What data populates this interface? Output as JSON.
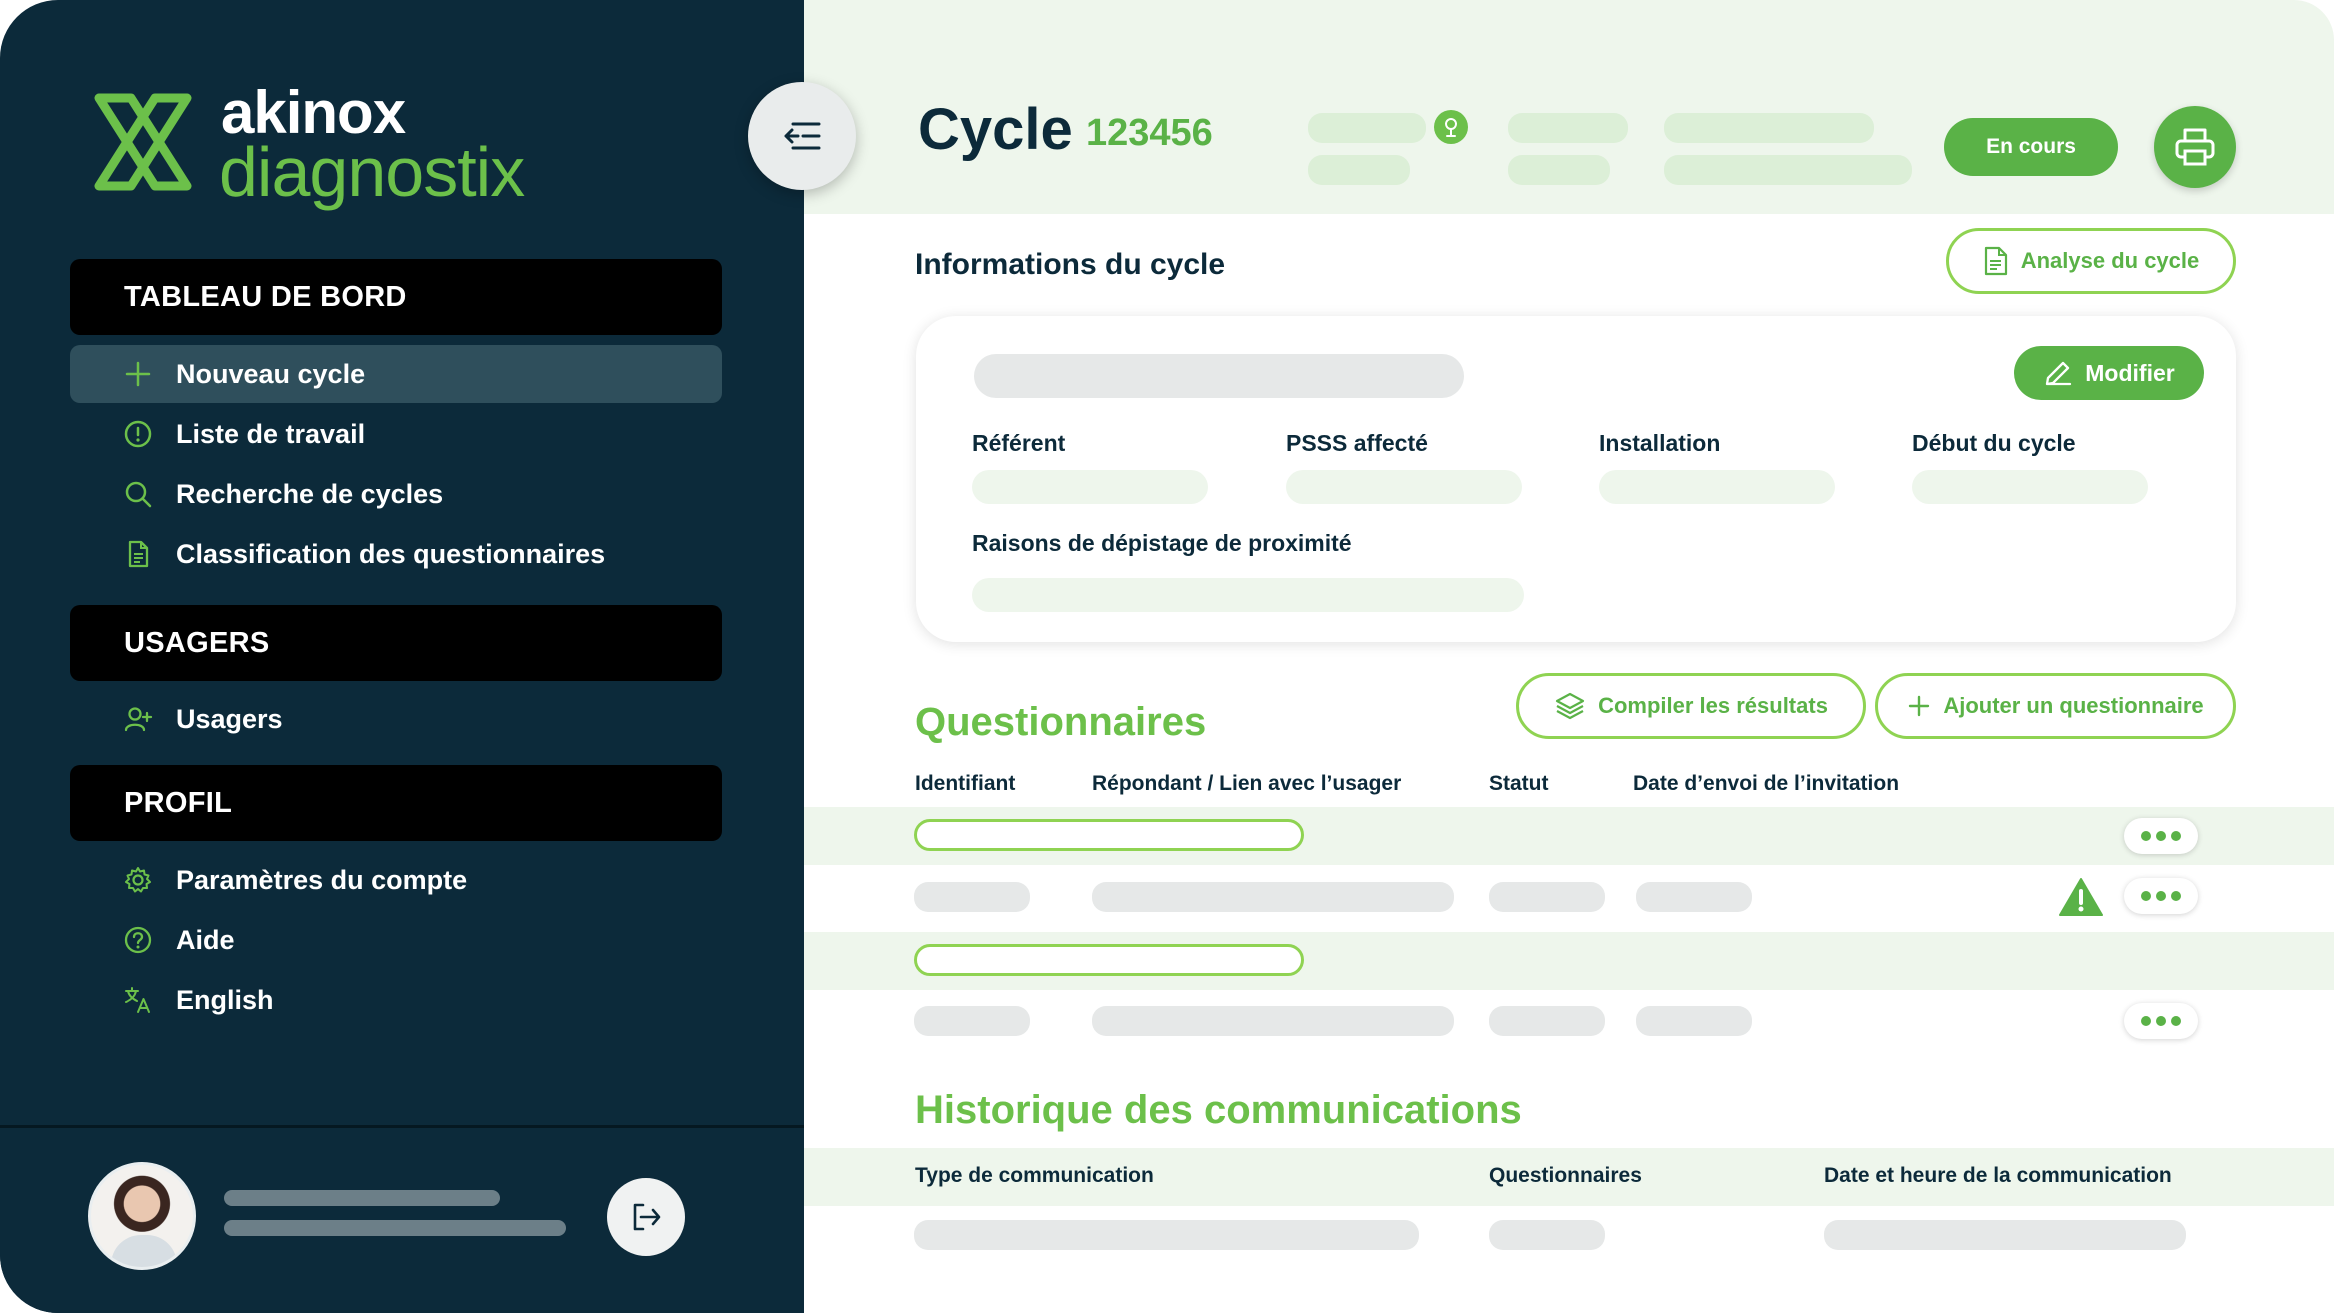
{
  "brand": {
    "name_top": "akinox",
    "name_bottom": "diagnostix",
    "colors": {
      "sidebar": "#0c2a3a",
      "accent": "#5ab247",
      "accent_light": "#eef6ec"
    }
  },
  "sidebar": {
    "sections": [
      {
        "title": "TABLEAU DE BORD"
      },
      {
        "title": "USAGERS"
      },
      {
        "title": "PROFIL"
      }
    ],
    "items": [
      {
        "label": "Nouveau cycle",
        "icon": "plus-icon",
        "active": true
      },
      {
        "label": "Liste de travail",
        "icon": "alert-circle-icon"
      },
      {
        "label": "Recherche de cycles",
        "icon": "search-icon"
      },
      {
        "label": "Classification des questionnaires",
        "icon": "document-icon"
      },
      {
        "label": "Usagers",
        "icon": "user-plus-icon"
      },
      {
        "label": "Paramètres du compte",
        "icon": "gear-icon"
      },
      {
        "label": "Aide",
        "icon": "help-circle-icon"
      },
      {
        "label": "English",
        "icon": "translate-icon"
      }
    ]
  },
  "header": {
    "title": "Cycle",
    "cycle_number": "123456",
    "status": "En cours"
  },
  "cycle_info": {
    "title": "Informations du cycle",
    "analyse_button": "Analyse du cycle",
    "modify_button": "Modifier",
    "fields": [
      "Référent",
      "PSSS affecté",
      "Installation",
      "Début du cycle"
    ],
    "reasons_label": "Raisons de dépistage de proximité"
  },
  "questionnaires": {
    "title": "Questionnaires",
    "compile_button": "Compiler les résultats",
    "add_button": "Ajouter un questionnaire",
    "columns": [
      "Identifiant",
      "Répondant / Lien avec l’usager",
      "Statut",
      "Date d’envoi de l’invitation"
    ]
  },
  "communications": {
    "title": "Historique des communications",
    "columns": [
      "Type de communication",
      "Questionnaires",
      "Date et heure de la communication"
    ]
  }
}
